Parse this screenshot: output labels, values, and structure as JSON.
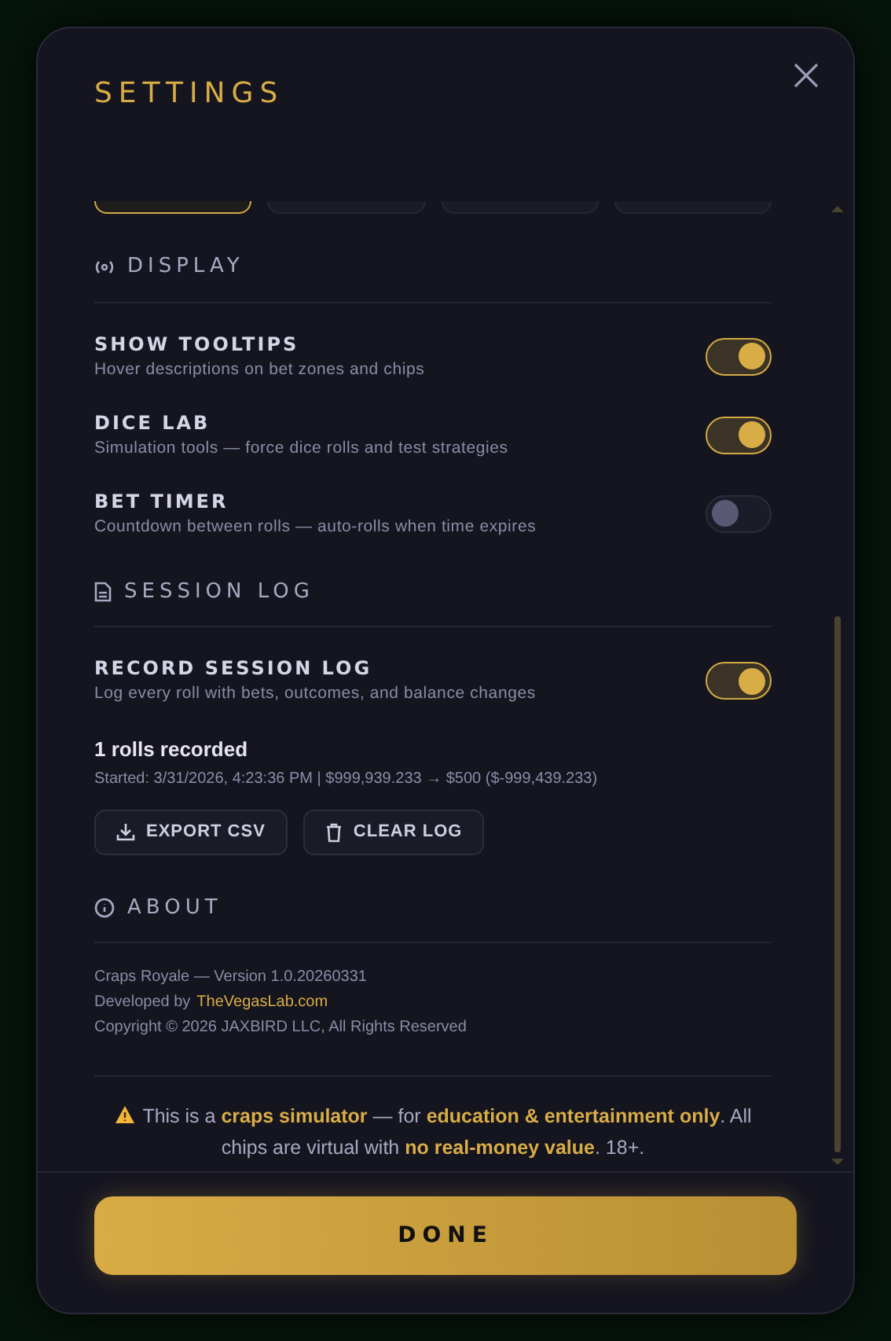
{
  "dialog": {
    "title": "SETTINGS"
  },
  "tabs": [
    {
      "selected": true
    },
    {
      "selected": false
    },
    {
      "selected": false
    },
    {
      "selected": false
    }
  ],
  "sections": [
    {
      "kind": "display",
      "heading": "DISPLAY",
      "toggles": [
        {
          "label": "SHOW TOOLTIPS",
          "description": "Hover descriptions on bet zones and chips",
          "on": true
        },
        {
          "label": "DICE LAB",
          "description": "Simulation tools — force dice rolls and test strategies",
          "on": true
        },
        {
          "label": "BET TIMER",
          "description": "Countdown between rolls — auto-rolls when time expires",
          "on": false
        }
      ]
    },
    {
      "kind": "log",
      "heading": "SESSION LOG",
      "toggles": [
        {
          "label": "RECORD SESSION LOG",
          "description": "Log every roll with bets, outcomes, and balance changes",
          "on": true
        }
      ],
      "summary": "1 rolls recorded",
      "started": "Started: 3/31/2026, 4:23:36 PM | $999,939.233 → $500 ($-999,439.233)",
      "buttons": [
        {
          "kind": "export",
          "label": "EXPORT CSV"
        },
        {
          "kind": "clear",
          "label": "CLEAR LOG"
        }
      ]
    },
    {
      "kind": "about",
      "heading": "ABOUT",
      "lines": [
        "Craps Royale — Version 1.0.20260331",
        "Copyright © 2026 JAXBIRD LLC, All Rights Reserved"
      ],
      "developer_prefix": "Developed by",
      "developer_link": "TheVegasLab.com"
    }
  ],
  "notice": "This is a **craps simulator** — for **education & entertainment only**. All chips are virtual with **no real-money value**. 18+.",
  "done_button": "DONE"
}
